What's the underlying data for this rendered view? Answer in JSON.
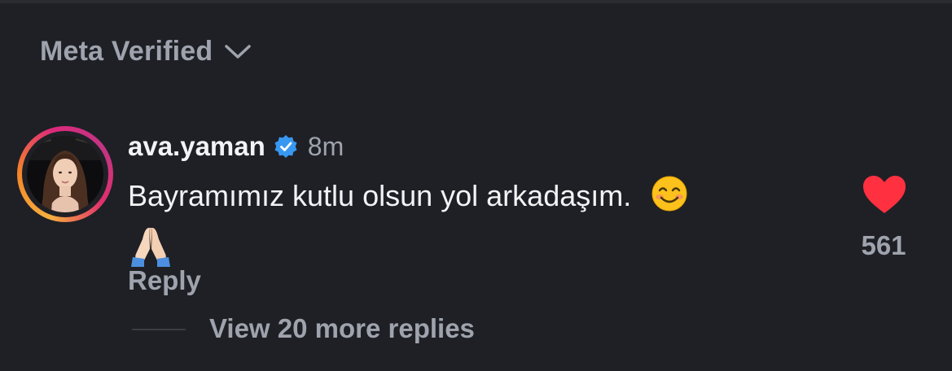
{
  "filter": {
    "label": "Meta Verified",
    "icon": "chevron-down-icon"
  },
  "comment": {
    "username": "ava.yaman",
    "verified": true,
    "time": "8m",
    "text": "Bayramımız kutlu olsun yol arkadaşım.",
    "emojis": [
      "😊",
      "🙏🏻"
    ],
    "reply_label": "Reply",
    "liked": true,
    "like_count": "561",
    "view_more_label": "View 20 more replies"
  },
  "colors": {
    "background": "#1f2025",
    "primary_text": "#f2f3f5",
    "secondary_text": "#9ea3ad",
    "verified_badge": "#3897f0",
    "like_heart": "#ff3040"
  }
}
